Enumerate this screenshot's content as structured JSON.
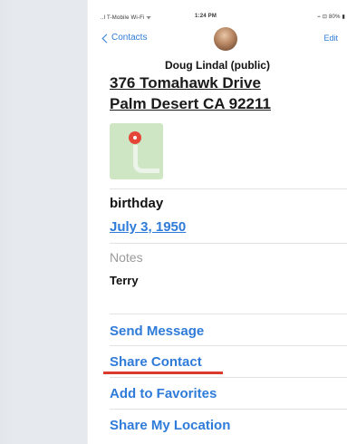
{
  "status_bar": {
    "carrier": "..l T-Mobile Wi-Fi ᯤ",
    "time": "1:24 PM",
    "battery": "⌁ ⊡ 80% ▮"
  },
  "nav": {
    "back_label": "Contacts",
    "edit_label": "Edit",
    "contact_name": "Doug Lindal (public)"
  },
  "address": {
    "line1": "376 Tomahawk Drive",
    "line2": "Palm Desert CA 92211"
  },
  "birthday": {
    "label": "birthday",
    "value": "July 3, 1950"
  },
  "notes": {
    "label": "Notes",
    "value": "Terry"
  },
  "actions": {
    "send_message": "Send Message",
    "share_contact": "Share Contact",
    "add_to_favorites": "Add to Favorites",
    "share_my_location": "Share My Location"
  },
  "colors": {
    "link": "#2f7bd9",
    "highlight_underline": "#d93a2b"
  }
}
